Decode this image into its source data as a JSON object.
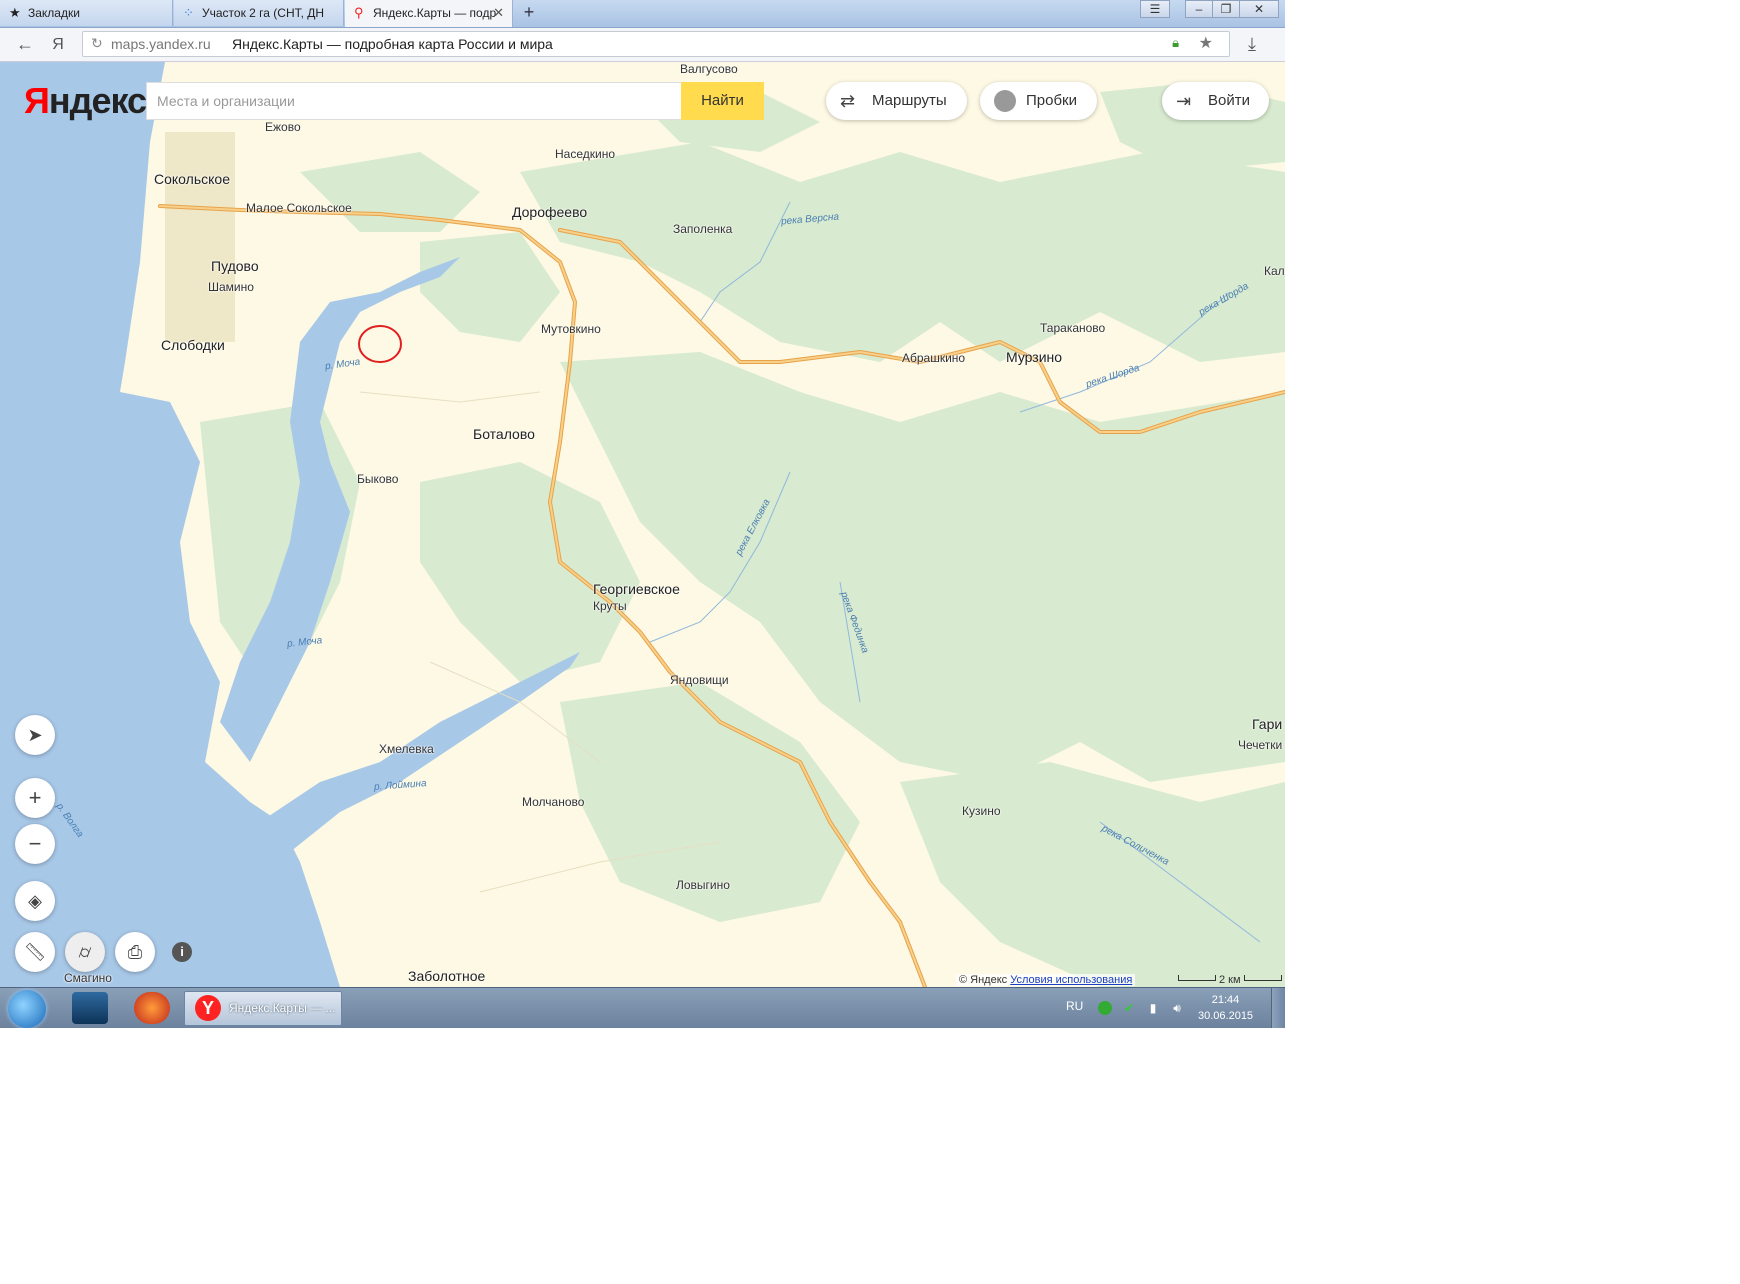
{
  "browser": {
    "tabs": [
      {
        "label": "Закладки",
        "icon": "star-icon",
        "state": "inactive"
      },
      {
        "label": "Участок 2 га (СНТ, ДН",
        "icon": "avito-dots-icon",
        "state": "inactive"
      },
      {
        "label": "Яндекс.Карты — подр",
        "icon": "map-pin-icon",
        "state": "active"
      }
    ],
    "window_controls": [
      "menu-icon",
      "minimize-icon",
      "restore-icon",
      "close-icon"
    ],
    "url_host": "maps.yandex.ru",
    "page_title": "Яндекс.Карты — подробная карта России и мира",
    "yandex_nav_letter": "Я"
  },
  "maps": {
    "logo": "Яндекс",
    "search_placeholder": "Места и организации",
    "find_label": "Найти",
    "routes_label": "Маршруты",
    "traffic_label": "Пробки",
    "login_label": "Войти",
    "copyright_symbol": "© Яндекс",
    "terms_label": "Условия использования",
    "scale_label": "2 км",
    "colors": {
      "land": "#fdf9e4",
      "forest": "#d8ead0",
      "water": "#a8c8e8",
      "road": "#f4b25c",
      "search_button": "#ffdb4d"
    },
    "places": {
      "valgusovo": "Валгусово",
      "ezhovo": "Ежово",
      "sokolskoe": "Сокольское",
      "nasedkino": "Наседкино",
      "maloe_sokolskoe": "Малое Сокольское",
      "dorofeevo": "Дорофеево",
      "zapolenka": "Заполенка",
      "pudovo": "Пудово",
      "shamino": "Шамино",
      "slobodki": "Слободки",
      "mutovkino": "Мутовкино",
      "botalovo": "Боталово",
      "bykovo": "Быково",
      "kal": "Кал",
      "tarakanovo": "Тараканово",
      "abrashkino": "Абрашкино",
      "murzino": "Мурзино",
      "georgievskoe": "Георгиевское",
      "kruty": "Круты",
      "yandovishchi": "Яндовищи",
      "khmelevka": "Хмелевка",
      "molchanovo": "Молчаново",
      "lovygino": "Ловыгино",
      "zabolotnoe": "Заболотное",
      "smagino": "Смагино",
      "kuzino": "Кузино",
      "gari": "Гари",
      "chechetki": "Чечетки"
    },
    "rivers": {
      "versna": "река Версна",
      "shorda1": "река Шорда",
      "shorda2": "река Шорда",
      "mocha1": "р. Моча",
      "mocha2": "р. Моча",
      "elkovka": "река Елковка",
      "fedinka": "река Фединка",
      "loimina": "р. Лоймина",
      "volga": "р. Волга",
      "solichenka": "река Соличенка"
    }
  },
  "taskbar": {
    "window_label": "Яндекс.Карты — ...",
    "lang": "RU",
    "time": "21:44",
    "date": "30.06.2015"
  }
}
